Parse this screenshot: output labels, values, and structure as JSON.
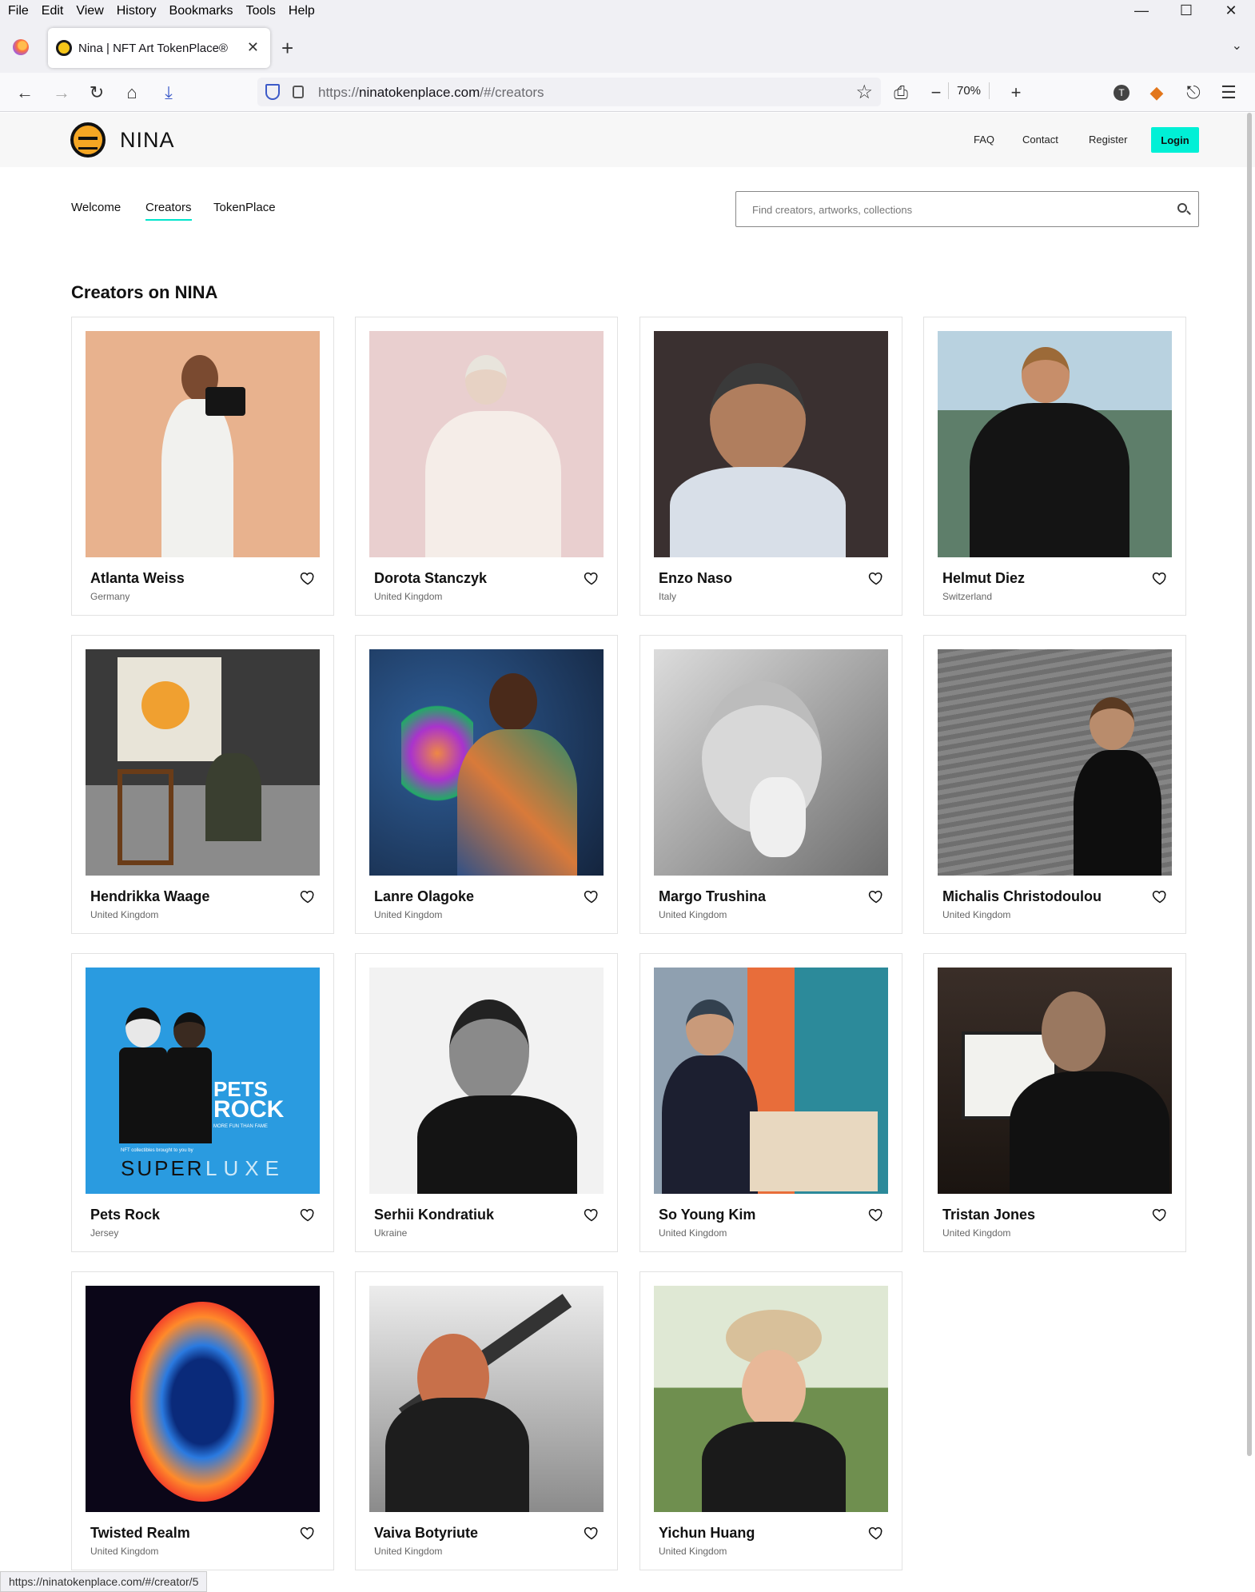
{
  "menubar": {
    "items": [
      "File",
      "Edit",
      "View",
      "History",
      "Bookmarks",
      "Tools",
      "Help"
    ],
    "accesskeys": [
      "F",
      "E",
      "V",
      "s",
      "B",
      "T",
      "H"
    ]
  },
  "browser": {
    "tab_title": "Nina | NFT Art TokenPlace®",
    "url_scheme": "https://",
    "url_host": "ninatokenplace.com",
    "url_path": "/#/creators",
    "zoom": "70%",
    "status_url": "https://ninatokenplace.com/#/creator/5",
    "icons": [
      "back-icon",
      "forward-icon",
      "reload-icon",
      "home-icon",
      "download-icon",
      "shield-icon",
      "lock-icon",
      "star-icon",
      "print-icon",
      "zoom-out-icon",
      "zoom-in-icon",
      "account-icon",
      "metamask-icon",
      "extensions-icon",
      "menu-icon"
    ]
  },
  "site": {
    "brand": "NINA",
    "nav": {
      "faq": "FAQ",
      "contact": "Contact",
      "register": "Register",
      "login": "Login"
    },
    "login_color": "#00f0d6",
    "tabs": [
      "Welcome",
      "Creators",
      "TokenPlace"
    ],
    "active_tab": "Creators",
    "search_placeholder": "Find creators, artworks, collections",
    "heading": "Creators on NINA"
  },
  "creators": [
    {
      "name": "Atlanta Weiss",
      "country": "Germany"
    },
    {
      "name": "Dorota Stanczyk",
      "country": "United Kingdom"
    },
    {
      "name": "Enzo Naso",
      "country": "Italy"
    },
    {
      "name": "Helmut Diez",
      "country": "Switzerland"
    },
    {
      "name": "Hendrikka Waage",
      "country": "United Kingdom"
    },
    {
      "name": "Lanre Olagoke",
      "country": "United Kingdom"
    },
    {
      "name": "Margo Trushina",
      "country": "United Kingdom"
    },
    {
      "name": "Michalis Christodoulou",
      "country": "United Kingdom"
    },
    {
      "name": "Pets Rock",
      "country": "Jersey"
    },
    {
      "name": "Serhii Kondratiuk",
      "country": "Ukraine"
    },
    {
      "name": "So Young Kim",
      "country": "United Kingdom"
    },
    {
      "name": "Tristan Jones",
      "country": "United Kingdom"
    },
    {
      "name": "Twisted Realm",
      "country": "United Kingdom"
    },
    {
      "name": "Vaiva Botyriute",
      "country": "United Kingdom"
    },
    {
      "name": "Yichun Huang",
      "country": "United Kingdom"
    }
  ],
  "pets_rock_art": {
    "line1": "PETS",
    "line2": "ROCK",
    "tagline": "MORE FUN THAN FAME",
    "credit": "NFT collectibles brought to you by",
    "brand_a": "SUPER",
    "brand_b": "LUXE"
  }
}
